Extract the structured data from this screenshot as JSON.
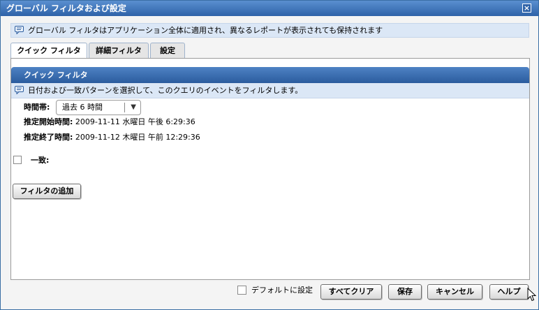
{
  "window": {
    "title": "グローバル フィルタおよび設定",
    "close_label": "×"
  },
  "info_banner": {
    "text": "グローバル フィルタはアプリケーション全体に適用され、異なるレポートが表示されても保持されます",
    "icon": "comment-icon"
  },
  "tabs": [
    {
      "label": "クイック フィルタ",
      "active": true
    },
    {
      "label": "詳細フィルタ",
      "active": false
    },
    {
      "label": "設定",
      "active": false
    }
  ],
  "panel": {
    "header": "クイック フィルタ",
    "info_text": "日付および一致パターンを選択して、このクエリのイベントをフィルタします。",
    "time_range_label": "時間帯:",
    "time_range_value": "過去 6 時間",
    "start_label": "推定開始時間:",
    "start_value": "2009-11-11 水曜日 午後 6:29:36",
    "end_label": "推定終了時間:",
    "end_value": "2009-11-12 木曜日 午前 12:29:36",
    "match_label": "一致:",
    "add_filter_label": "フィルタの追加"
  },
  "footer": {
    "default_label": "デフォルトに設定",
    "clear_all_label": "すべてクリア",
    "save_label": "保存",
    "cancel_label": "キャンセル",
    "help_label": "ヘルプ"
  }
}
